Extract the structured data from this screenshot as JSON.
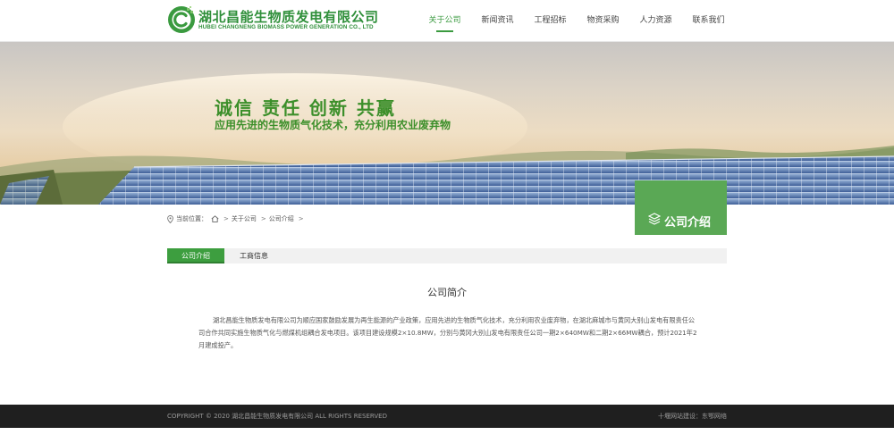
{
  "header": {
    "logo_cn": "湖北昌能生物质发电有限公司",
    "logo_en": "HUBEI CHANGNENG BIOMASS POWER GENERATION CO., LTD",
    "logo_letter": "C",
    "nav": [
      {
        "label": "关于公司",
        "active": true
      },
      {
        "label": "新闻资讯",
        "active": false
      },
      {
        "label": "工程招标",
        "active": false
      },
      {
        "label": "物资采购",
        "active": false
      },
      {
        "label": "人力资源",
        "active": false
      },
      {
        "label": "联系我们",
        "active": false
      }
    ]
  },
  "banner": {
    "slogan": "诚信  责任  创新  共赢",
    "subtitle": "应用先进的生物质气化技术，充分利用农业废弃物",
    "section_title": "公司介绍"
  },
  "breadcrumb": {
    "prefix": "当前位置：",
    "items": [
      "关于公司",
      "公司介绍"
    ]
  },
  "tabs": [
    {
      "label": "公司介绍",
      "active": true
    },
    {
      "label": "工商信息",
      "active": false
    }
  ],
  "content": {
    "title": "公司简介",
    "body": "湖北昌能生物质发电有限公司为顺应国家鼓励发展为再生能源的产业政策，应用先进的生物质气化技术，充分利用农业废弃物，在湖北麻城市与黄冈大别山发电有限责任公司合作共同实施生物质气化与燃煤机组耦合发电项目。该项目建设规模2×10.8MW，分别与黄冈大别山发电有限责任公司一期2×640MW和二期2×66MW耦合，预计2021年2月建成投产。"
  },
  "footer": {
    "copyright": "COPYRIGHT © 2020 湖北昌能生物质发电有限公司 ALL RIGHTS RESERVED",
    "credit_prefix": "十堰网站建设：",
    "credit_link": "东鄂网络"
  },
  "colors": {
    "brand_green": "#3a9a3f",
    "section_box": "#5aa855",
    "footer_bg": "#1f1f1f"
  },
  "icons": [
    "logo-icon",
    "location-pin-icon",
    "home-icon",
    "layers-icon"
  ]
}
